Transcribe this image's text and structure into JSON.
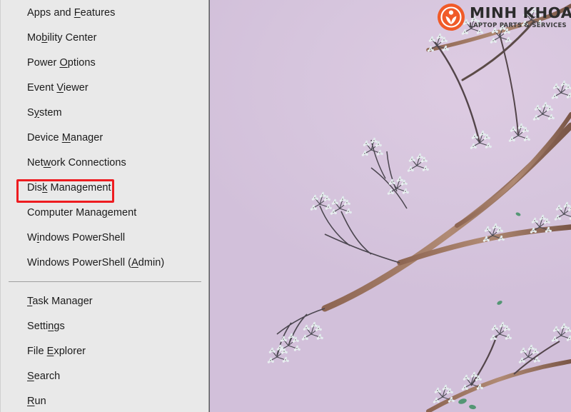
{
  "wallpaper": {
    "description": "lavender sky with bare cherry tree branches",
    "background_color": "#d5c4dd",
    "branch_color": "#a9836e",
    "blossom_color": "#e8eef0"
  },
  "watermark_logo": {
    "brand": "MINH KHOA",
    "tagline": "LAPTOP PARTS & SERVICES",
    "mark_name": "minh-khoa-circle-logo",
    "accent_color": "#f05a28"
  },
  "power_menu": {
    "name": "Windows power user menu",
    "background_color": "#e9e9e9",
    "border_color": "#5d5d63",
    "groups": [
      {
        "items": [
          {
            "label": "Apps and Features",
            "pre": "Apps and ",
            "key": "F",
            "post": "eatures"
          },
          {
            "label": "Mobility Center",
            "pre": "Mo",
            "key": "b",
            "post": "ility Center"
          },
          {
            "label": "Power Options",
            "pre": "Power ",
            "key": "O",
            "post": "ptions"
          },
          {
            "label": "Event Viewer",
            "pre": "Event ",
            "key": "V",
            "post": "iewer"
          },
          {
            "label": "System",
            "pre": "S",
            "key": "y",
            "post": "stem"
          },
          {
            "label": "Device Manager",
            "pre": "Device ",
            "key": "M",
            "post": "anager"
          },
          {
            "label": "Network Connections",
            "pre": "Net",
            "key": "w",
            "post": "ork Connections"
          },
          {
            "label": "Disk Management",
            "pre": "Dis",
            "key": "k",
            "post": " Management"
          },
          {
            "label": "Computer Management",
            "pre": "Computer Mana",
            "key": "g",
            "post": "ement"
          },
          {
            "label": "Windows PowerShell",
            "pre": "W",
            "key": "i",
            "post": "ndows PowerShell"
          },
          {
            "label": "Windows PowerShell (Admin)",
            "pre": "Windows PowerShell (",
            "key": "A",
            "post": "dmin)"
          }
        ]
      },
      {
        "items": [
          {
            "label": "Task Manager",
            "pre": "",
            "key": "T",
            "post": "ask Manager"
          },
          {
            "label": "Settings",
            "pre": "Setti",
            "key": "n",
            "post": "gs"
          },
          {
            "label": "File Explorer",
            "pre": "File ",
            "key": "E",
            "post": "xplorer"
          },
          {
            "label": "Search",
            "pre": "",
            "key": "S",
            "post": "earch"
          },
          {
            "label": "Run",
            "pre": "",
            "key": "R",
            "post": "un"
          }
        ]
      }
    ]
  },
  "annotation": {
    "highlighted_item": "Disk Management",
    "color": "#ee1c20",
    "shape": "rectangle"
  }
}
